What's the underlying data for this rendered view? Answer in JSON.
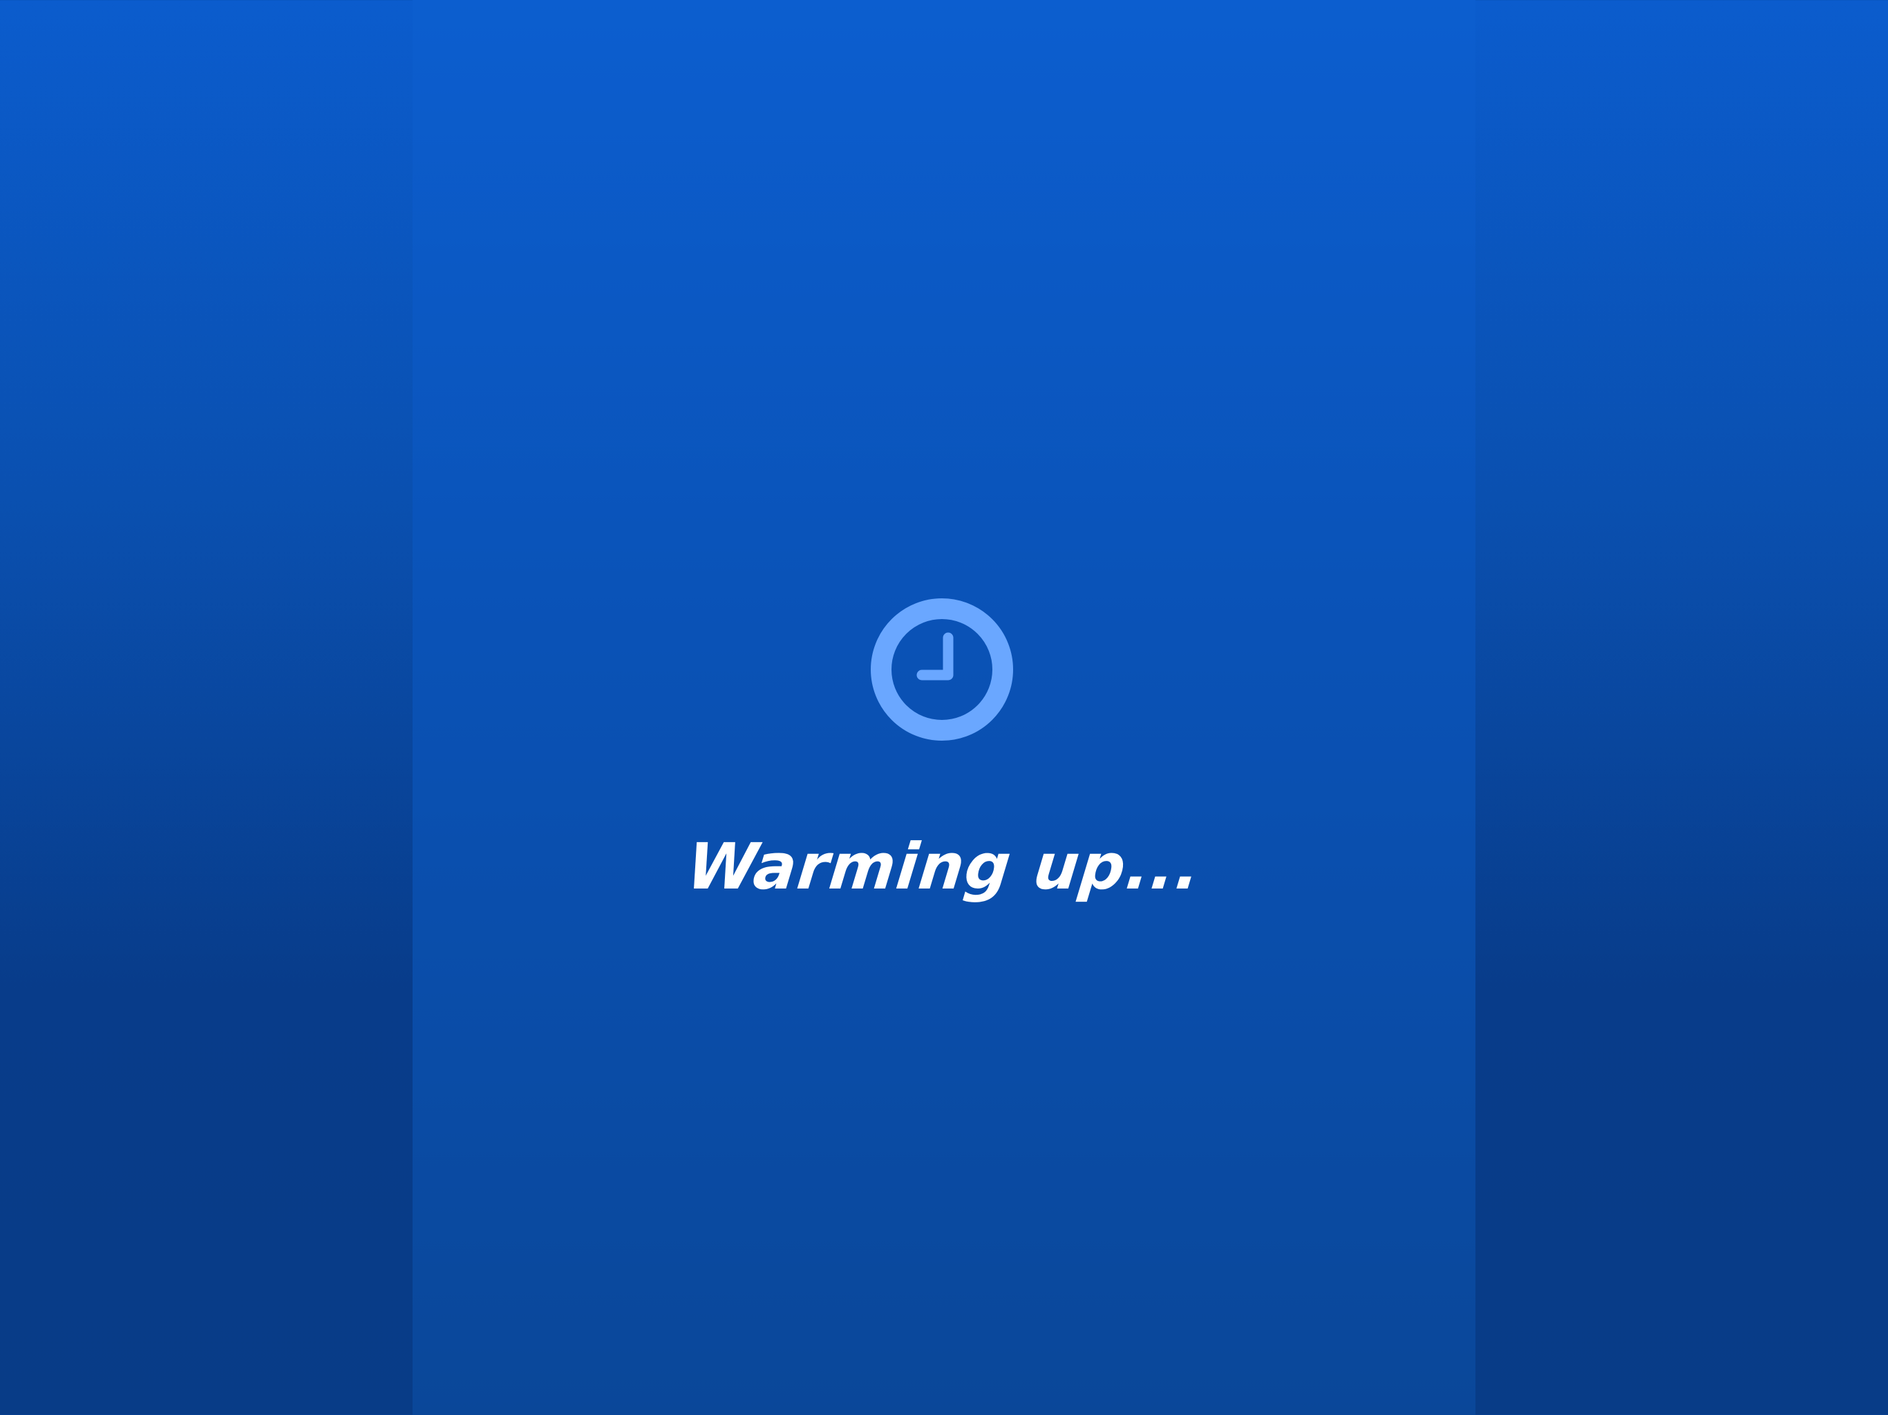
{
  "loading_screen": {
    "status_text": "Warming up...",
    "icon": "clock-icon"
  },
  "colors": {
    "background_top": "#0b5ccd",
    "background_bottom": "#083c87",
    "center_panel_top": "#0c5ecf",
    "center_panel_bottom": "#0a4799",
    "icon_color": "#6aa7ff",
    "text_color": "#ffffff"
  }
}
